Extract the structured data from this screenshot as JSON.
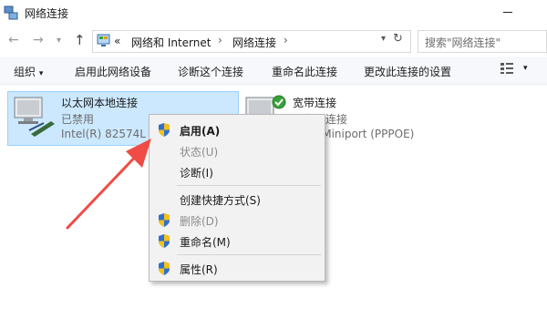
{
  "window": {
    "title": "网络连接"
  },
  "address": {
    "crumbs": [
      "«",
      "网络和 Internet",
      "›",
      "网络连接",
      "›"
    ]
  },
  "search": {
    "placeholder": "搜索\"网络连接\""
  },
  "commands": {
    "organize": "组织",
    "enable_device": "启用此网络设备",
    "diagnose": "诊断这个连接",
    "rename": "重命名此连接",
    "change_settings": "更改此连接的设置"
  },
  "connections": [
    {
      "name": "以太网本地连接",
      "status": "已禁用",
      "device": "Intel(R) 82574L G"
    },
    {
      "name": "宽带连接",
      "status": "已断开连接",
      "device": "WAN Miniport (PPPOE)"
    }
  ],
  "context_menu": [
    {
      "label": "启用(A)",
      "shield": true,
      "bold": true,
      "disabled": false
    },
    {
      "label": "状态(U)",
      "shield": false,
      "bold": false,
      "disabled": true
    },
    {
      "label": "诊断(I)",
      "shield": false,
      "bold": false,
      "disabled": false
    },
    {
      "label": "创建快捷方式(S)",
      "shield": false,
      "bold": false,
      "disabled": false
    },
    {
      "label": "删除(D)",
      "shield": true,
      "bold": false,
      "disabled": true
    },
    {
      "label": "重命名(M)",
      "shield": true,
      "bold": false,
      "disabled": false
    },
    {
      "label": "属性(R)",
      "shield": true,
      "bold": false,
      "disabled": false
    }
  ],
  "annotation": {
    "arrow_color": "#f04b45"
  },
  "colors": {
    "selection": "#cce8ff",
    "selection_border": "#99d1ff",
    "shield_blue": "#2f6fd0",
    "shield_yellow": "#f3c21a",
    "check_green": "#3aa03a"
  }
}
